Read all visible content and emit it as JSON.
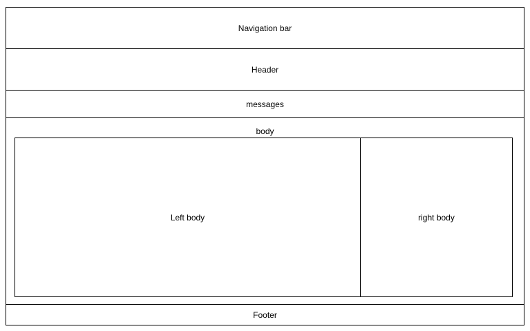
{
  "sections": {
    "navigation_bar": "Navigation bar",
    "header": "Header",
    "messages": "messages",
    "body": "body",
    "left_body": "Left body",
    "right_body": "right body",
    "footer": "Footer"
  }
}
